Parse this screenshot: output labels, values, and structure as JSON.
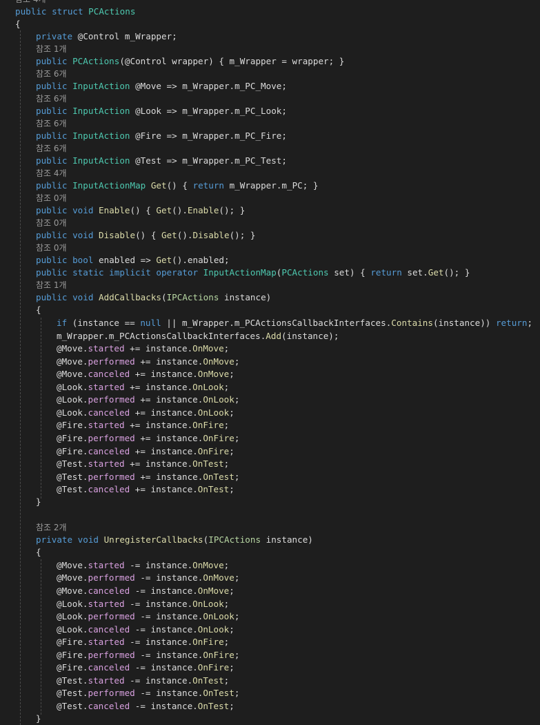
{
  "editor": {
    "lens_top": "참조 4개",
    "lines": [
      [
        [
          "kw",
          "public struct "
        ],
        [
          "type",
          "PCActions"
        ]
      ],
      [
        [
          "pl",
          "{"
        ]
      ],
      [
        [
          "kw",
          "private "
        ],
        [
          "pl",
          "@Control m_Wrapper;"
        ]
      ],
      [
        [
          "cl",
          "참조 1개"
        ]
      ],
      [
        [
          "kw",
          "public "
        ],
        [
          "type",
          "PCActions"
        ],
        [
          "pl",
          "(@Control wrapper) { m_Wrapper = wrapper; }"
        ]
      ],
      [
        [
          "cl",
          "참조 6개"
        ]
      ],
      [
        [
          "kw",
          "public "
        ],
        [
          "type",
          "InputAction"
        ],
        [
          "pl",
          " @Move => m_Wrapper.m_PC_Move;"
        ]
      ],
      [
        [
          "cl",
          "참조 6개"
        ]
      ],
      [
        [
          "kw",
          "public "
        ],
        [
          "type",
          "InputAction"
        ],
        [
          "pl",
          " @Look => m_Wrapper.m_PC_Look;"
        ]
      ],
      [
        [
          "cl",
          "참조 6개"
        ]
      ],
      [
        [
          "kw",
          "public "
        ],
        [
          "type",
          "InputAction"
        ],
        [
          "pl",
          " @Fire => m_Wrapper.m_PC_Fire;"
        ]
      ],
      [
        [
          "cl",
          "참조 6개"
        ]
      ],
      [
        [
          "kw",
          "public "
        ],
        [
          "type",
          "InputAction"
        ],
        [
          "pl",
          " @Test => m_Wrapper.m_PC_Test;"
        ]
      ],
      [
        [
          "cl",
          "참조 4개"
        ]
      ],
      [
        [
          "kw",
          "public "
        ],
        [
          "type",
          "InputActionMap"
        ],
        [
          "pl",
          " "
        ],
        [
          "method",
          "Get"
        ],
        [
          "pl",
          "() { "
        ],
        [
          "kw",
          "return "
        ],
        [
          "pl",
          "m_Wrapper.m_PC; }"
        ]
      ],
      [
        [
          "cl",
          "참조 0개"
        ]
      ],
      [
        [
          "kw",
          "public void "
        ],
        [
          "method",
          "Enable"
        ],
        [
          "pl",
          "() { "
        ],
        [
          "method",
          "Get"
        ],
        [
          "pl",
          "()."
        ],
        [
          "method",
          "Enable"
        ],
        [
          "pl",
          "(); }"
        ]
      ],
      [
        [
          "cl",
          "참조 0개"
        ]
      ],
      [
        [
          "kw",
          "public void "
        ],
        [
          "method",
          "Disable"
        ],
        [
          "pl",
          "() { "
        ],
        [
          "method",
          "Get"
        ],
        [
          "pl",
          "()."
        ],
        [
          "method",
          "Disable"
        ],
        [
          "pl",
          "(); }"
        ]
      ],
      [
        [
          "cl",
          "참조 0개"
        ]
      ],
      [
        [
          "kw",
          "public bool "
        ],
        [
          "pl",
          "enabled => "
        ],
        [
          "method",
          "Get"
        ],
        [
          "pl",
          "().enabled;"
        ]
      ],
      [
        [
          "kw",
          "public static implicit operator "
        ],
        [
          "type",
          "InputActionMap"
        ],
        [
          "pl",
          "("
        ],
        [
          "type",
          "PCActions"
        ],
        [
          "pl",
          " set) { "
        ],
        [
          "kw",
          "return "
        ],
        [
          "pl",
          "set."
        ],
        [
          "method",
          "Get"
        ],
        [
          "pl",
          "(); }"
        ]
      ],
      [
        [
          "cl",
          "참조 1개"
        ]
      ],
      [
        [
          "kw",
          "public void "
        ],
        [
          "method",
          "AddCallbacks"
        ],
        [
          "pl",
          "("
        ],
        [
          "iface",
          "IPCActions"
        ],
        [
          "pl",
          " instance)"
        ]
      ],
      [
        [
          "pl",
          "{"
        ]
      ],
      [
        [
          "kw",
          "if "
        ],
        [
          "pl",
          "(instance == "
        ],
        [
          "kw",
          "null"
        ],
        [
          "pl",
          " || m_Wrapper.m_PCActionsCallbackInterfaces."
        ],
        [
          "method",
          "Contains"
        ],
        [
          "pl",
          "(instance)) "
        ],
        [
          "kw",
          "return"
        ],
        [
          "pl",
          ";"
        ]
      ],
      [
        [
          "pl",
          "m_Wrapper.m_PCActionsCallbackInterfaces."
        ],
        [
          "method",
          "Add"
        ],
        [
          "pl",
          "(instance);"
        ]
      ],
      [
        [
          "pl",
          "@Move."
        ],
        [
          "evt",
          "started"
        ],
        [
          "pl",
          " += instance."
        ],
        [
          "method",
          "OnMove"
        ],
        [
          "pl",
          ";"
        ]
      ],
      [
        [
          "pl",
          "@Move."
        ],
        [
          "evt",
          "performed"
        ],
        [
          "pl",
          " += instance."
        ],
        [
          "method",
          "OnMove"
        ],
        [
          "pl",
          ";"
        ]
      ],
      [
        [
          "pl",
          "@Move."
        ],
        [
          "evt",
          "canceled"
        ],
        [
          "pl",
          " += instance."
        ],
        [
          "method",
          "OnMove"
        ],
        [
          "pl",
          ";"
        ]
      ],
      [
        [
          "pl",
          "@Look."
        ],
        [
          "evt",
          "started"
        ],
        [
          "pl",
          " += instance."
        ],
        [
          "method",
          "OnLook"
        ],
        [
          "pl",
          ";"
        ]
      ],
      [
        [
          "pl",
          "@Look."
        ],
        [
          "evt",
          "performed"
        ],
        [
          "pl",
          " += instance."
        ],
        [
          "method",
          "OnLook"
        ],
        [
          "pl",
          ";"
        ]
      ],
      [
        [
          "pl",
          "@Look."
        ],
        [
          "evt",
          "canceled"
        ],
        [
          "pl",
          " += instance."
        ],
        [
          "method",
          "OnLook"
        ],
        [
          "pl",
          ";"
        ]
      ],
      [
        [
          "pl",
          "@Fire."
        ],
        [
          "evt",
          "started"
        ],
        [
          "pl",
          " += instance."
        ],
        [
          "method",
          "OnFire"
        ],
        [
          "pl",
          ";"
        ]
      ],
      [
        [
          "pl",
          "@Fire."
        ],
        [
          "evt",
          "performed"
        ],
        [
          "pl",
          " += instance."
        ],
        [
          "method",
          "OnFire"
        ],
        [
          "pl",
          ";"
        ]
      ],
      [
        [
          "pl",
          "@Fire."
        ],
        [
          "evt",
          "canceled"
        ],
        [
          "pl",
          " += instance."
        ],
        [
          "method",
          "OnFire"
        ],
        [
          "pl",
          ";"
        ]
      ],
      [
        [
          "pl",
          "@Test."
        ],
        [
          "evt",
          "started"
        ],
        [
          "pl",
          " += instance."
        ],
        [
          "method",
          "OnTest"
        ],
        [
          "pl",
          ";"
        ]
      ],
      [
        [
          "pl",
          "@Test."
        ],
        [
          "evt",
          "performed"
        ],
        [
          "pl",
          " += instance."
        ],
        [
          "method",
          "OnTest"
        ],
        [
          "pl",
          ";"
        ]
      ],
      [
        [
          "pl",
          "@Test."
        ],
        [
          "evt",
          "canceled"
        ],
        [
          "pl",
          " += instance."
        ],
        [
          "method",
          "OnTest"
        ],
        [
          "pl",
          ";"
        ]
      ],
      [
        [
          "pl",
          "}"
        ]
      ],
      [],
      [
        [
          "cl",
          "참조 2개"
        ]
      ],
      [
        [
          "kw",
          "private void "
        ],
        [
          "method",
          "UnregisterCallbacks"
        ],
        [
          "pl",
          "("
        ],
        [
          "iface",
          "IPCActions"
        ],
        [
          "pl",
          " instance)"
        ]
      ],
      [
        [
          "pl",
          "{"
        ]
      ],
      [
        [
          "pl",
          "@Move."
        ],
        [
          "evt",
          "started"
        ],
        [
          "pl",
          " -= instance."
        ],
        [
          "method",
          "OnMove"
        ],
        [
          "pl",
          ";"
        ]
      ],
      [
        [
          "pl",
          "@Move."
        ],
        [
          "evt",
          "performed"
        ],
        [
          "pl",
          " -= instance."
        ],
        [
          "method",
          "OnMove"
        ],
        [
          "pl",
          ";"
        ]
      ],
      [
        [
          "pl",
          "@Move."
        ],
        [
          "evt",
          "canceled"
        ],
        [
          "pl",
          " -= instance."
        ],
        [
          "method",
          "OnMove"
        ],
        [
          "pl",
          ";"
        ]
      ],
      [
        [
          "pl",
          "@Look."
        ],
        [
          "evt",
          "started"
        ],
        [
          "pl",
          " -= instance."
        ],
        [
          "method",
          "OnLook"
        ],
        [
          "pl",
          ";"
        ]
      ],
      [
        [
          "pl",
          "@Look."
        ],
        [
          "evt",
          "performed"
        ],
        [
          "pl",
          " -= instance."
        ],
        [
          "method",
          "OnLook"
        ],
        [
          "pl",
          ";"
        ]
      ],
      [
        [
          "pl",
          "@Look."
        ],
        [
          "evt",
          "canceled"
        ],
        [
          "pl",
          " -= instance."
        ],
        [
          "method",
          "OnLook"
        ],
        [
          "pl",
          ";"
        ]
      ],
      [
        [
          "pl",
          "@Fire."
        ],
        [
          "evt",
          "started"
        ],
        [
          "pl",
          " -= instance."
        ],
        [
          "method",
          "OnFire"
        ],
        [
          "pl",
          ";"
        ]
      ],
      [
        [
          "pl",
          "@Fire."
        ],
        [
          "evt",
          "performed"
        ],
        [
          "pl",
          " -= instance."
        ],
        [
          "method",
          "OnFire"
        ],
        [
          "pl",
          ";"
        ]
      ],
      [
        [
          "pl",
          "@Fire."
        ],
        [
          "evt",
          "canceled"
        ],
        [
          "pl",
          " -= instance."
        ],
        [
          "method",
          "OnFire"
        ],
        [
          "pl",
          ";"
        ]
      ],
      [
        [
          "pl",
          "@Test."
        ],
        [
          "evt",
          "started"
        ],
        [
          "pl",
          " -= instance."
        ],
        [
          "method",
          "OnTest"
        ],
        [
          "pl",
          ";"
        ]
      ],
      [
        [
          "pl",
          "@Test."
        ],
        [
          "evt",
          "performed"
        ],
        [
          "pl",
          " -= instance."
        ],
        [
          "method",
          "OnTest"
        ],
        [
          "pl",
          ";"
        ]
      ],
      [
        [
          "pl",
          "@Test."
        ],
        [
          "evt",
          "canceled"
        ],
        [
          "pl",
          " -= instance."
        ],
        [
          "method",
          "OnTest"
        ],
        [
          "pl",
          ";"
        ]
      ],
      [
        [
          "pl",
          "}"
        ]
      ]
    ]
  }
}
